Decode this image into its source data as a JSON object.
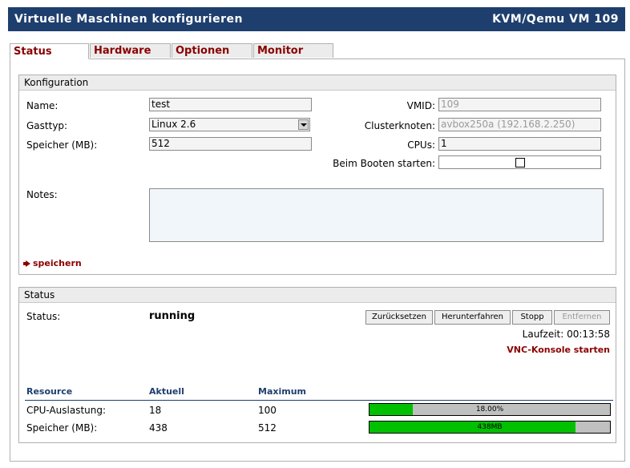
{
  "header": {
    "title": "Virtuelle Maschinen konfigurieren",
    "vm": "KVM/Qemu VM 109"
  },
  "tabs": [
    {
      "label": "Status"
    },
    {
      "label": "Hardware"
    },
    {
      "label": "Optionen"
    },
    {
      "label": "Monitor"
    }
  ],
  "config": {
    "title": "Konfiguration",
    "name_label": "Name:",
    "name_value": "test",
    "gasttyp_label": "Gasttyp:",
    "gasttyp_value": "Linux 2.6",
    "speicher_label": "Speicher (MB):",
    "speicher_value": "512",
    "vmid_label": "VMID:",
    "vmid_value": "109",
    "cluster_label": "Clusterknoten:",
    "cluster_value": "avbox250a (192.168.2.250)",
    "cpus_label": "CPUs:",
    "cpus_value": "1",
    "boot_label": "Beim Booten starten:",
    "boot_checked": false,
    "notes_label": "Notes:",
    "notes_value": "",
    "save_label": "speichern"
  },
  "status": {
    "title": "Status",
    "status_label": "Status:",
    "status_value": "running",
    "buttons": [
      "Zurücksetzen",
      "Herunterfahren",
      "Stopp",
      "Entfernen"
    ],
    "uptime": "Laufzeit: 00:13:58",
    "vnc_label": "VNC-Konsole starten",
    "table_headers": [
      "Resource",
      "Aktuell",
      "Maximum"
    ],
    "rows": [
      {
        "resource": "CPU-Auslastung:",
        "current": "18",
        "maximum": "100",
        "bar_text": "18.00%",
        "fraction": 0.18
      },
      {
        "resource": "Speicher (MB):",
        "current": "438",
        "maximum": "512",
        "bar_text": "438MB",
        "fraction": 0.855
      }
    ]
  },
  "colors": {
    "header_bg": "#1e3f6e",
    "tab_text": "#8b0000",
    "bar_fill": "#00c000",
    "link": "#8b0000"
  }
}
